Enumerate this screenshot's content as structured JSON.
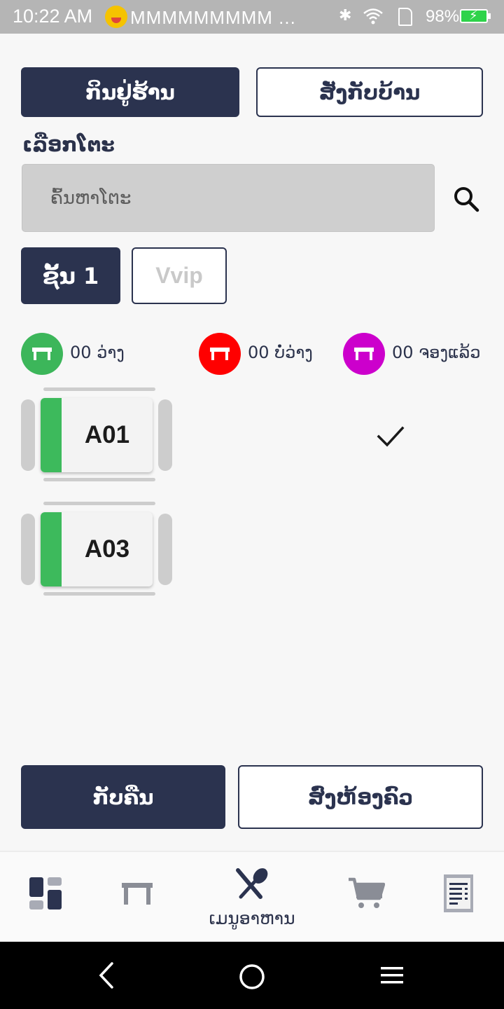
{
  "status_bar": {
    "time": "10:22 AM",
    "notifications": "MMMMMMMMM ...",
    "battery": "98%",
    "icons": [
      "emoji-icon",
      "bluetooth-icon",
      "wifi-icon",
      "sim-icon",
      "battery-icon"
    ]
  },
  "order_type": {
    "dine_in": "ກິນຢູ່ຮ້ານ",
    "takeaway": "ສັ່ງກັບບ້ານ",
    "selected": "dine_in"
  },
  "table_select": {
    "label": "ເລືອກໂຕະ",
    "search_placeholder": "ຄົ້ນຫາໂຕະ",
    "search_value": ""
  },
  "floors": {
    "items": [
      "ຊັ້ນ 1",
      "Vvip"
    ],
    "selected": "ຊັ້ນ 1"
  },
  "legend": [
    {
      "count": "00",
      "label": "ວ່າງ",
      "color": "#3cb65a"
    },
    {
      "count": "00",
      "label": "ບໍ່ວ່າງ",
      "color": "#ff0000"
    },
    {
      "count": "00",
      "label": "ຈອງແລ້ວ",
      "color": "#cc00cc"
    }
  ],
  "tables": [
    {
      "name": "A01",
      "status_color": "#3dba5c",
      "selected": true
    },
    {
      "name": "A03",
      "status_color": "#3dba5c",
      "selected": false
    }
  ],
  "actions": {
    "back": "ກັບຄືນ",
    "send_kitchen": "ສົ່ງຫ້ອງຄົວ"
  },
  "bottom_nav": {
    "items": [
      {
        "icon": "dashboard-icon",
        "label": ""
      },
      {
        "icon": "table-icon",
        "label": ""
      },
      {
        "icon": "food-menu-icon",
        "label": "ເມນູອາຫານ",
        "active": true
      },
      {
        "icon": "cart-icon",
        "label": ""
      },
      {
        "icon": "receipt-icon",
        "label": ""
      }
    ]
  },
  "colors": {
    "primary": "#2b334f",
    "available": "#3cb65a",
    "occupied": "#ff0000",
    "reserved": "#cc00cc"
  }
}
